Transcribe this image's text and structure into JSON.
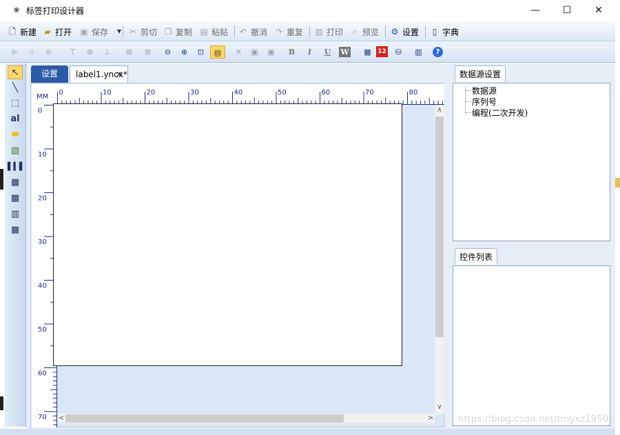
{
  "window": {
    "title": "标签打印设计器",
    "app_icon": "app-icon",
    "min_icon": "—",
    "max_icon": "☐",
    "close_icon": "✕"
  },
  "toolbar_main": [
    {
      "name": "new",
      "label": "新建",
      "icon": "📄",
      "enabled": true
    },
    {
      "name": "open",
      "label": "打开",
      "icon": "📂",
      "enabled": true
    },
    {
      "name": "save",
      "label": "保存",
      "icon": "💾",
      "enabled": false
    },
    {
      "name": "cut",
      "label": "剪切",
      "icon": "✂",
      "enabled": false
    },
    {
      "name": "copy",
      "label": "复制",
      "icon": "❐",
      "enabled": false
    },
    {
      "name": "paste",
      "label": "粘贴",
      "icon": "📋",
      "enabled": false
    },
    {
      "name": "undo",
      "label": "撤消",
      "icon": "↶",
      "enabled": false
    },
    {
      "name": "redo",
      "label": "重复",
      "icon": "↷",
      "enabled": false
    },
    {
      "name": "print",
      "label": "打印",
      "icon": "🖶",
      "enabled": false
    },
    {
      "name": "preview",
      "label": "预览",
      "icon": "🔍",
      "enabled": false
    },
    {
      "name": "settings",
      "label": "设置",
      "icon": "⚙",
      "enabled": true
    },
    {
      "name": "dictionary",
      "label": "字典",
      "icon": "📖",
      "enabled": true
    }
  ],
  "toolbar_format": {
    "bold": "B",
    "italic": "I",
    "underline": "U",
    "wordart": "W",
    "serial": "12",
    "help": "?"
  },
  "document_tabs": {
    "settings_tab": "设置",
    "file_tab": "label1.yncx*",
    "close_glyph": "✕"
  },
  "ruler": {
    "unit": "MM",
    "h_labels": [
      "0",
      "10",
      "20",
      "30",
      "40",
      "50",
      "60",
      "70",
      "80"
    ],
    "v_labels": [
      "0",
      "10",
      "20",
      "30",
      "40",
      "50",
      "60",
      "70"
    ]
  },
  "scroll": {
    "up": "∧",
    "down": "∨",
    "left": "<",
    "right": ">"
  },
  "datasource_panel": {
    "tab": "数据源设置",
    "tree": [
      "数据源",
      "序列号",
      "编程(二次开发)"
    ]
  },
  "controls_panel": {
    "tab": "控件列表"
  },
  "watermark": "https://blog.csdn.net/tmyxz1950",
  "status_text": "",
  "colors": {
    "active_tab": "#2b5aa6",
    "selected_tool": "#fcd86b",
    "toolbar_gradient": "#dde8f6"
  }
}
